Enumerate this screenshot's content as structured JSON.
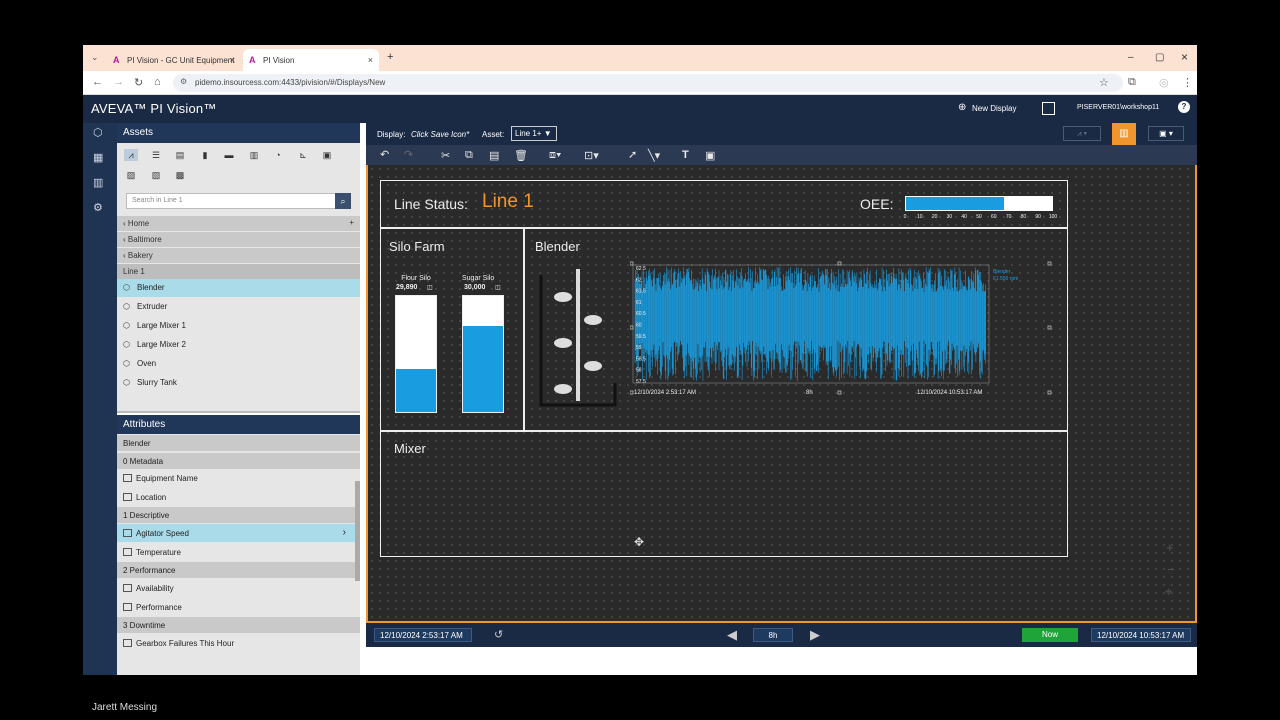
{
  "browser": {
    "tabs": [
      {
        "title": "PI Vision - GC Unit Equipment",
        "close": "×"
      },
      {
        "title": "PI Vision",
        "close": "×"
      }
    ],
    "new_tab": "+",
    "window_controls": {
      "minimize": "–",
      "maximize": "▢",
      "close": "×"
    },
    "url": "pidemo.insourcess.com:4433/pivision/#/Displays/New"
  },
  "app": {
    "brand": "AVEVA™ PI Vision™",
    "new_display": "New Display",
    "server": "PISERVER01\\workshop11",
    "help": "?"
  },
  "assets": {
    "title": "Assets",
    "search_placeholder": "Search in Line 1",
    "breadcrumbs": [
      "Home",
      "Baltimore",
      "Bakery"
    ],
    "current": "Line 1",
    "items": [
      "Blender",
      "Extruder",
      "Large Mixer 1",
      "Large Mixer 2",
      "Oven",
      "Slurry Tank"
    ],
    "selected": "Blender"
  },
  "attributes": {
    "title": "Attributes",
    "context": "Blender",
    "rows": [
      {
        "type": "group",
        "label": "0 Metadata"
      },
      {
        "type": "attr",
        "label": "Equipment Name"
      },
      {
        "type": "attr",
        "label": "Location"
      },
      {
        "type": "group",
        "label": "1 Descriptive"
      },
      {
        "type": "attr",
        "label": "Agitator Speed",
        "selected": true
      },
      {
        "type": "attr",
        "label": "Temperature"
      },
      {
        "type": "group",
        "label": "2 Performance"
      },
      {
        "type": "attr",
        "label": "Availability"
      },
      {
        "type": "attr",
        "label": "Performance"
      },
      {
        "type": "group",
        "label": "3 Downtime"
      },
      {
        "type": "attr",
        "label": "Gearbox Failures This Hour"
      }
    ]
  },
  "display_bar": {
    "display_label": "Display:",
    "display_value": "Click Save Icon*",
    "asset_label": "Asset:",
    "asset_value": "Line 1+"
  },
  "display": {
    "line_status_label": "Line Status:",
    "line_status_value": "Line 1",
    "oee_label": "OEE:",
    "oee_value_pct": 67,
    "oee_ticks": [
      "0",
      "10",
      "20",
      "30",
      "40",
      "50",
      "60",
      "70",
      "80",
      "90",
      "100"
    ],
    "silo_farm_title": "Silo Farm",
    "silos": [
      {
        "name": "Flour Silo",
        "value": "29,890",
        "fill_pct": 37
      },
      {
        "name": "Sugar Silo",
        "value": "30,000",
        "fill_pct": 74
      }
    ],
    "blender_title": "Blender",
    "trend": {
      "y_ticks": [
        "62.5",
        "62",
        "61.5",
        "61",
        "60.5",
        "60",
        "59.5",
        "59",
        "58.5",
        "58",
        "57.5"
      ],
      "start": "12/10/2024 2:53:17 AM",
      "duration": "8h",
      "end": "12/10/2024 10:53:17 AM",
      "legend_name": "Blender",
      "legend_value": "61.556 rpm"
    },
    "mixer_title": "Mixer"
  },
  "timebar": {
    "start": "12/10/2024 2:53:17 AM",
    "duration": "8h",
    "now": "Now",
    "end": "12/10/2024 10:53:17 AM"
  },
  "presenter": "Jarett Messing",
  "colors": {
    "accent": "#f0962c",
    "fill": "#1a9de0",
    "header": "#1a2a44",
    "now": "#1fa43a",
    "selected": "#a9dbe9"
  }
}
